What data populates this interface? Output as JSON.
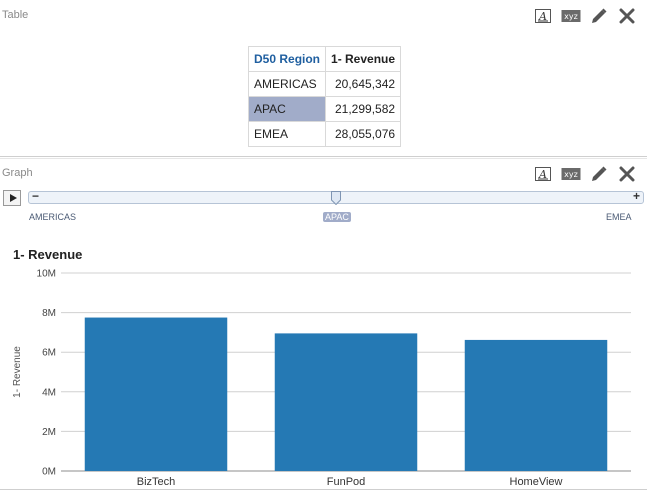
{
  "table_view": {
    "label": "Table",
    "headers": [
      "D50 Region",
      "1- Revenue"
    ],
    "rows": [
      [
        "AMERICAS",
        "20,645,342"
      ],
      [
        "APAC",
        "21,299,582"
      ],
      [
        "EMEA",
        "28,055,076"
      ]
    ],
    "selected_row": 1
  },
  "graph_view": {
    "label": "Graph",
    "slider": {
      "labels": [
        "AMERICAS",
        "APAC",
        "EMEA"
      ],
      "selected_index": 1,
      "minus": "−",
      "plus": "+"
    }
  },
  "toolbar": {
    "icons": [
      "format-text-icon",
      "xyz-icon",
      "pencil-icon",
      "close-icon"
    ],
    "xyz_text": "xyz"
  },
  "colors": {
    "bar": "#2579b4",
    "selection": "#a1acc9",
    "header_link": "#1f5fa0"
  },
  "chart_data": {
    "type": "bar",
    "title": "1- Revenue",
    "ylabel": "1- Revenue",
    "xlabel": "",
    "categories": [
      "BizTech",
      "FunPod",
      "HomeView"
    ],
    "values": [
      7750000,
      6950000,
      6620000
    ],
    "ylim": [
      0,
      10000000
    ],
    "yticks": [
      0,
      2000000,
      4000000,
      6000000,
      8000000,
      10000000
    ],
    "ytick_labels": [
      "0M",
      "2M",
      "4M",
      "6M",
      "8M",
      "10M"
    ],
    "grid": true
  }
}
